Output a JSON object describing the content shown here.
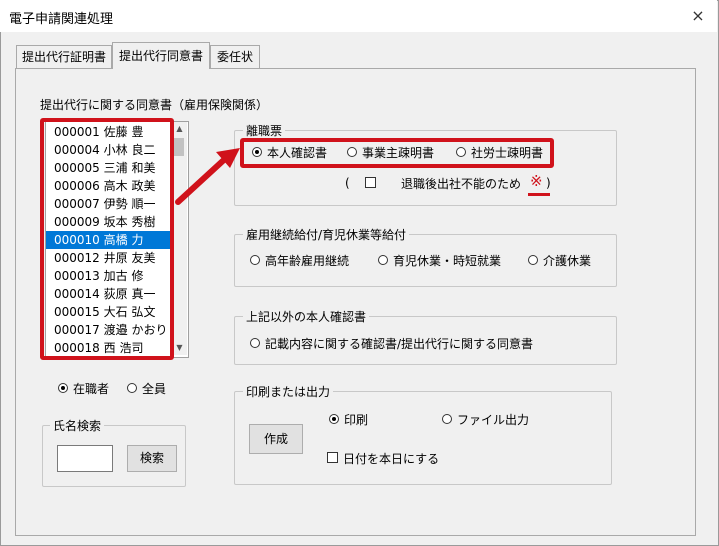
{
  "window": {
    "title": "電子申請関連処理",
    "close_icon": "×"
  },
  "tabs": [
    {
      "label": "提出代行証明書"
    },
    {
      "label": "提出代行同意書"
    },
    {
      "label": "委任状"
    }
  ],
  "heading": "提出代行に関する同意書（雇用保険関係）",
  "employees": [
    {
      "label": "000001 佐藤 豊"
    },
    {
      "label": "000004 小林 良二"
    },
    {
      "label": "000005 三浦 和美"
    },
    {
      "label": "000006 高木 政美"
    },
    {
      "label": "000007 伊勢 順一"
    },
    {
      "label": "000009 坂本 秀樹"
    },
    {
      "label": "000010 高橋 力",
      "selected": true
    },
    {
      "label": "000012 井原 友美"
    },
    {
      "label": "000013 加古 修"
    },
    {
      "label": "000014 荻原 真一"
    },
    {
      "label": "000015 大石 弘文"
    },
    {
      "label": "000017 渡邉 かおり"
    },
    {
      "label": "000018 西 浩司"
    }
  ],
  "status_filter": {
    "in_office": "在職者",
    "all": "全員",
    "selected": "in_office"
  },
  "name_search": {
    "label": "氏名検索",
    "value": "",
    "button": "検索"
  },
  "rishokuhyo": {
    "label": "離職票",
    "options": [
      "本人確認書",
      "事業主疎明書",
      "社労士疎明書"
    ],
    "selected": 0,
    "paren_open": "(",
    "paren_close": ")",
    "checkbox_label": "退職後出社不能のため",
    "note_mark": "※"
  },
  "koyou": {
    "label": "雇用継続給付/育児休業等給付",
    "options": [
      "高年齢雇用継続",
      "育児休業・時短就業",
      "介護休業"
    ]
  },
  "other": {
    "label": "上記以外の本人確認書",
    "option": "記載内容に関する確認書/提出代行に関する同意書"
  },
  "output": {
    "label": "印刷または出力",
    "create_button": "作成",
    "print": "印刷",
    "file": "ファイル出力",
    "selected": "print",
    "date_checkbox": "日付を本日にする"
  },
  "colors": {
    "highlight": "#d0121b",
    "selection": "#0078d7"
  }
}
